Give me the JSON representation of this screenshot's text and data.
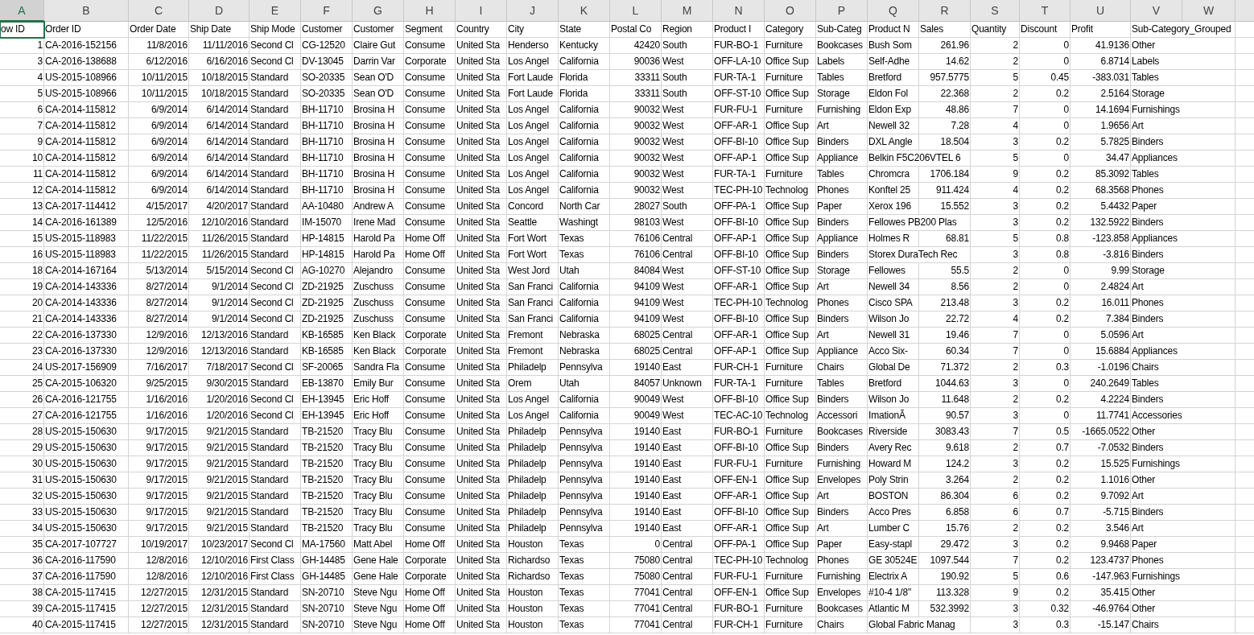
{
  "columns": [
    {
      "letter": "A",
      "kind": "number",
      "selected": true
    },
    {
      "letter": "B",
      "kind": "text",
      "selected": false
    },
    {
      "letter": "C",
      "kind": "number",
      "selected": false
    },
    {
      "letter": "D",
      "kind": "number",
      "selected": false
    },
    {
      "letter": "E",
      "kind": "text",
      "selected": false
    },
    {
      "letter": "F",
      "kind": "text",
      "selected": false
    },
    {
      "letter": "G",
      "kind": "text",
      "selected": false
    },
    {
      "letter": "H",
      "kind": "text",
      "selected": false
    },
    {
      "letter": "I",
      "kind": "text",
      "selected": false
    },
    {
      "letter": "J",
      "kind": "text",
      "selected": false
    },
    {
      "letter": "K",
      "kind": "text",
      "selected": false
    },
    {
      "letter": "L",
      "kind": "number",
      "selected": false
    },
    {
      "letter": "M",
      "kind": "text",
      "selected": false
    },
    {
      "letter": "N",
      "kind": "text",
      "selected": false
    },
    {
      "letter": "O",
      "kind": "text",
      "selected": false
    },
    {
      "letter": "P",
      "kind": "text",
      "selected": false
    },
    {
      "letter": "Q",
      "kind": "text",
      "selected": false
    },
    {
      "letter": "R",
      "kind": "number",
      "selected": false
    },
    {
      "letter": "S",
      "kind": "number",
      "selected": false
    },
    {
      "letter": "T",
      "kind": "number",
      "selected": false
    },
    {
      "letter": "U",
      "kind": "number",
      "selected": false
    },
    {
      "letter": "V",
      "kind": "text",
      "selected": false
    },
    {
      "letter": "W",
      "selected": false
    }
  ],
  "header_row": [
    {
      "text": "ow ID",
      "selected": true
    },
    {
      "text": "Order ID",
      "selected": false
    },
    {
      "text": "Order Date",
      "selected": false
    },
    {
      "text": "Ship Date",
      "selected": false
    },
    {
      "text": "Ship Mode",
      "selected": false
    },
    {
      "text": "Customer",
      "selected": false
    },
    {
      "text": "Customer",
      "selected": false
    },
    {
      "text": "Segment",
      "selected": false
    },
    {
      "text": "Country",
      "selected": false
    },
    {
      "text": "City",
      "selected": false
    },
    {
      "text": "State",
      "selected": false
    },
    {
      "text": "Postal Co",
      "selected": false
    },
    {
      "text": "Region",
      "selected": false
    },
    {
      "text": "Product I",
      "selected": false
    },
    {
      "text": "Category",
      "selected": false
    },
    {
      "text": "Sub-Categ",
      "selected": false
    },
    {
      "text": "Product N",
      "selected": false
    },
    {
      "text": "Sales",
      "selected": false
    },
    {
      "text": "Quantity",
      "selected": false
    },
    {
      "text": "Discount",
      "selected": false
    },
    {
      "text": "Profit",
      "selected": false
    },
    {
      "text": "Sub-Category_Grouped",
      "selected": false
    }
  ],
  "rows": [
    [
      "1",
      "CA-2016-152156",
      "11/8/2016",
      "11/11/2016",
      "Second Cl",
      "CG-12520",
      "Claire Gut",
      "Consume",
      "United Sta",
      "Henderso",
      "Kentucky",
      "42420",
      "South",
      "FUR-BO-1",
      "Furniture",
      "Bookcases",
      "Bush Som",
      "261.96",
      "2",
      "0",
      "41.9136",
      "Other"
    ],
    [
      "3",
      "CA-2016-138688",
      "6/12/2016",
      "6/16/2016",
      "Second Cl",
      "DV-13045",
      "Darrin Var",
      "Corporate",
      "United Sta",
      "Los Angel",
      "California",
      "90036",
      "West",
      "OFF-LA-10",
      "Office Sup",
      "Labels",
      "Self-Adhe",
      "14.62",
      "2",
      "0",
      "6.8714",
      "Labels"
    ],
    [
      "4",
      "US-2015-108966",
      "10/11/2015",
      "10/18/2015",
      "Standard",
      "SO-20335",
      "Sean O'D",
      "Consume",
      "United Sta",
      "Fort Laude",
      "Florida",
      "33311",
      "South",
      "FUR-TA-1",
      "Furniture",
      "Tables",
      "Bretford",
      "957.5775",
      "5",
      "0.45",
      "-383.031",
      "Tables"
    ],
    [
      "5",
      "US-2015-108966",
      "10/11/2015",
      "10/18/2015",
      "Standard",
      "SO-20335",
      "Sean O'D",
      "Consume",
      "United Sta",
      "Fort Laude",
      "Florida",
      "33311",
      "South",
      "OFF-ST-10",
      "Office Sup",
      "Storage",
      "Eldon Fol",
      "22.368",
      "2",
      "0.2",
      "2.5164",
      "Storage"
    ],
    [
      "6",
      "CA-2014-115812",
      "6/9/2014",
      "6/14/2014",
      "Standard",
      "BH-11710",
      "Brosina H",
      "Consume",
      "United Sta",
      "Los Angel",
      "California",
      "90032",
      "West",
      "FUR-FU-1",
      "Furniture",
      "Furnishing",
      "Eldon Exp",
      "48.86",
      "7",
      "0",
      "14.1694",
      "Furnishings"
    ],
    [
      "7",
      "CA-2014-115812",
      "6/9/2014",
      "6/14/2014",
      "Standard",
      "BH-11710",
      "Brosina H",
      "Consume",
      "United Sta",
      "Los Angel",
      "California",
      "90032",
      "West",
      "OFF-AR-1",
      "Office Sup",
      "Art",
      "Newell 32",
      "7.28",
      "4",
      "0",
      "1.9656",
      "Art"
    ],
    [
      "9",
      "CA-2014-115812",
      "6/9/2014",
      "6/14/2014",
      "Standard",
      "BH-11710",
      "Brosina H",
      "Consume",
      "United Sta",
      "Los Angel",
      "California",
      "90032",
      "West",
      "OFF-BI-10",
      "Office Sup",
      "Binders",
      "DXL Angle",
      "18.504",
      "3",
      "0.2",
      "5.7825",
      "Binders"
    ],
    [
      "10",
      "CA-2014-115812",
      "6/9/2014",
      "6/14/2014",
      "Standard",
      "BH-11710",
      "Brosina H",
      "Consume",
      "United Sta",
      "Los Angel",
      "California",
      "90032",
      "West",
      "OFF-AP-1",
      "Office Sup",
      "Appliance",
      "Belkin F5C206VTEL 6",
      null,
      "5",
      "0",
      "34.47",
      "Appliances"
    ],
    [
      "11",
      "CA-2014-115812",
      "6/9/2014",
      "6/14/2014",
      "Standard",
      "BH-11710",
      "Brosina H",
      "Consume",
      "United Sta",
      "Los Angel",
      "California",
      "90032",
      "West",
      "FUR-TA-1",
      "Furniture",
      "Tables",
      "Chromcra",
      "1706.184",
      "9",
      "0.2",
      "85.3092",
      "Tables"
    ],
    [
      "12",
      "CA-2014-115812",
      "6/9/2014",
      "6/14/2014",
      "Standard",
      "BH-11710",
      "Brosina H",
      "Consume",
      "United Sta",
      "Los Angel",
      "California",
      "90032",
      "West",
      "TEC-PH-10",
      "Technolog",
      "Phones",
      "Konftel 25",
      "911.424",
      "4",
      "0.2",
      "68.3568",
      "Phones"
    ],
    [
      "13",
      "CA-2017-114412",
      "4/15/2017",
      "4/20/2017",
      "Standard",
      "AA-10480",
      "Andrew A",
      "Consume",
      "United Sta",
      "Concord",
      "North Car",
      "28027",
      "South",
      "OFF-PA-1",
      "Office Sup",
      "Paper",
      "Xerox 196",
      "15.552",
      "3",
      "0.2",
      "5.4432",
      "Paper"
    ],
    [
      "14",
      "CA-2016-161389",
      "12/5/2016",
      "12/10/2016",
      "Standard",
      "IM-15070",
      "Irene Mad",
      "Consume",
      "United Sta",
      "Seattle",
      "Washingt",
      "98103",
      "West",
      "OFF-BI-10",
      "Office Sup",
      "Binders",
      "Fellowes PB200 Plas",
      null,
      "3",
      "0.2",
      "132.5922",
      "Binders"
    ],
    [
      "15",
      "US-2015-118983",
      "11/22/2015",
      "11/26/2015",
      "Standard",
      "HP-14815",
      "Harold Pa",
      "Home Off",
      "United Sta",
      "Fort Wort",
      "Texas",
      "76106",
      "Central",
      "OFF-AP-1",
      "Office Sup",
      "Appliance",
      "Holmes R",
      "68.81",
      "5",
      "0.8",
      "-123.858",
      "Appliances"
    ],
    [
      "16",
      "US-2015-118983",
      "11/22/2015",
      "11/26/2015",
      "Standard",
      "HP-14815",
      "Harold Pa",
      "Home Off",
      "United Sta",
      "Fort Wort",
      "Texas",
      "76106",
      "Central",
      "OFF-BI-10",
      "Office Sup",
      "Binders",
      "Storex DuraTech Rec",
      null,
      "3",
      "0.8",
      "-3.816",
      "Binders"
    ],
    [
      "18",
      "CA-2014-167164",
      "5/13/2014",
      "5/15/2014",
      "Second Cl",
      "AG-10270",
      "Alejandro",
      "Consume",
      "United Sta",
      "West Jord",
      "Utah",
      "84084",
      "West",
      "OFF-ST-10",
      "Office Sup",
      "Storage",
      "Fellowes",
      "55.5",
      "2",
      "0",
      "9.99",
      "Storage"
    ],
    [
      "19",
      "CA-2014-143336",
      "8/27/2014",
      "9/1/2014",
      "Second Cl",
      "ZD-21925",
      "Zuschuss",
      "Consume",
      "United Sta",
      "San Franci",
      "California",
      "94109",
      "West",
      "OFF-AR-1",
      "Office Sup",
      "Art",
      "Newell 34",
      "8.56",
      "2",
      "0",
      "2.4824",
      "Art"
    ],
    [
      "20",
      "CA-2014-143336",
      "8/27/2014",
      "9/1/2014",
      "Second Cl",
      "ZD-21925",
      "Zuschuss",
      "Consume",
      "United Sta",
      "San Franci",
      "California",
      "94109",
      "West",
      "TEC-PH-10",
      "Technolog",
      "Phones",
      "Cisco SPA",
      "213.48",
      "3",
      "0.2",
      "16.011",
      "Phones"
    ],
    [
      "21",
      "CA-2014-143336",
      "8/27/2014",
      "9/1/2014",
      "Second Cl",
      "ZD-21925",
      "Zuschuss",
      "Consume",
      "United Sta",
      "San Franci",
      "California",
      "94109",
      "West",
      "OFF-BI-10",
      "Office Sup",
      "Binders",
      "Wilson Jo",
      "22.72",
      "4",
      "0.2",
      "7.384",
      "Binders"
    ],
    [
      "22",
      "CA-2016-137330",
      "12/9/2016",
      "12/13/2016",
      "Standard",
      "KB-16585",
      "Ken Black",
      "Corporate",
      "United Sta",
      "Fremont",
      "Nebraska",
      "68025",
      "Central",
      "OFF-AR-1",
      "Office Sup",
      "Art",
      "Newell 31",
      "19.46",
      "7",
      "0",
      "5.0596",
      "Art"
    ],
    [
      "23",
      "CA-2016-137330",
      "12/9/2016",
      "12/13/2016",
      "Standard",
      "KB-16585",
      "Ken Black",
      "Corporate",
      "United Sta",
      "Fremont",
      "Nebraska",
      "68025",
      "Central",
      "OFF-AP-1",
      "Office Sup",
      "Appliance",
      "Acco Six-",
      "60.34",
      "7",
      "0",
      "15.6884",
      "Appliances"
    ],
    [
      "24",
      "US-2017-156909",
      "7/16/2017",
      "7/18/2017",
      "Second Cl",
      "SF-20065",
      "Sandra Fla",
      "Consume",
      "United Sta",
      "Philadelp",
      "Pennsylva",
      "19140",
      "East",
      "FUR-CH-1",
      "Furniture",
      "Chairs",
      "Global De",
      "71.372",
      "2",
      "0.3",
      "-1.0196",
      "Chairs"
    ],
    [
      "25",
      "CA-2015-106320",
      "9/25/2015",
      "9/30/2015",
      "Standard",
      "EB-13870",
      "Emily Bur",
      "Consume",
      "United Sta",
      "Orem",
      "Utah",
      "84057",
      "Unknown",
      "FUR-TA-1",
      "Furniture",
      "Tables",
      "Bretford",
      "1044.63",
      "3",
      "0",
      "240.2649",
      "Tables"
    ],
    [
      "26",
      "CA-2016-121755",
      "1/16/2016",
      "1/20/2016",
      "Second Cl",
      "EH-13945",
      "Eric Hoff",
      "Consume",
      "United Sta",
      "Los Angel",
      "California",
      "90049",
      "West",
      "OFF-BI-10",
      "Office Sup",
      "Binders",
      "Wilson Jo",
      "11.648",
      "2",
      "0.2",
      "4.2224",
      "Binders"
    ],
    [
      "27",
      "CA-2016-121755",
      "1/16/2016",
      "1/20/2016",
      "Second Cl",
      "EH-13945",
      "Eric Hoff",
      "Consume",
      "United Sta",
      "Los Angel",
      "California",
      "90049",
      "West",
      "TEC-AC-10",
      "Technolog",
      "Accessori",
      "ImationÃ",
      "90.57",
      "3",
      "0",
      "11.7741",
      "Accessories"
    ],
    [
      "28",
      "US-2015-150630",
      "9/17/2015",
      "9/21/2015",
      "Standard",
      "TB-21520",
      "Tracy Blu",
      "Consume",
      "United Sta",
      "Philadelp",
      "Pennsylva",
      "19140",
      "East",
      "FUR-BO-1",
      "Furniture",
      "Bookcases",
      "Riverside",
      "3083.43",
      "7",
      "0.5",
      "-1665.0522",
      "Other"
    ],
    [
      "29",
      "US-2015-150630",
      "9/17/2015",
      "9/21/2015",
      "Standard",
      "TB-21520",
      "Tracy Blu",
      "Consume",
      "United Sta",
      "Philadelp",
      "Pennsylva",
      "19140",
      "East",
      "OFF-BI-10",
      "Office Sup",
      "Binders",
      "Avery Rec",
      "9.618",
      "2",
      "0.7",
      "-7.0532",
      "Binders"
    ],
    [
      "30",
      "US-2015-150630",
      "9/17/2015",
      "9/21/2015",
      "Standard",
      "TB-21520",
      "Tracy Blu",
      "Consume",
      "United Sta",
      "Philadelp",
      "Pennsylva",
      "19140",
      "East",
      "FUR-FU-1",
      "Furniture",
      "Furnishing",
      "Howard M",
      "124.2",
      "3",
      "0.2",
      "15.525",
      "Furnishings"
    ],
    [
      "31",
      "US-2015-150630",
      "9/17/2015",
      "9/21/2015",
      "Standard",
      "TB-21520",
      "Tracy Blu",
      "Consume",
      "United Sta",
      "Philadelp",
      "Pennsylva",
      "19140",
      "East",
      "OFF-EN-1",
      "Office Sup",
      "Envelopes",
      "Poly Strin",
      "3.264",
      "2",
      "0.2",
      "1.1016",
      "Other"
    ],
    [
      "32",
      "US-2015-150630",
      "9/17/2015",
      "9/21/2015",
      "Standard",
      "TB-21520",
      "Tracy Blu",
      "Consume",
      "United Sta",
      "Philadelp",
      "Pennsylva",
      "19140",
      "East",
      "OFF-AR-1",
      "Office Sup",
      "Art",
      "BOSTON",
      "86.304",
      "6",
      "0.2",
      "9.7092",
      "Art"
    ],
    [
      "33",
      "US-2015-150630",
      "9/17/2015",
      "9/21/2015",
      "Standard",
      "TB-21520",
      "Tracy Blu",
      "Consume",
      "United Sta",
      "Philadelp",
      "Pennsylva",
      "19140",
      "East",
      "OFF-BI-10",
      "Office Sup",
      "Binders",
      "Acco Pres",
      "6.858",
      "6",
      "0.7",
      "-5.715",
      "Binders"
    ],
    [
      "34",
      "US-2015-150630",
      "9/17/2015",
      "9/21/2015",
      "Standard",
      "TB-21520",
      "Tracy Blu",
      "Consume",
      "United Sta",
      "Philadelp",
      "Pennsylva",
      "19140",
      "East",
      "OFF-AR-1",
      "Office Sup",
      "Art",
      "Lumber C",
      "15.76",
      "2",
      "0.2",
      "3.546",
      "Art"
    ],
    [
      "35",
      "CA-2017-107727",
      "10/19/2017",
      "10/23/2017",
      "Second Cl",
      "MA-17560",
      "Matt Abel",
      "Home Off",
      "United Sta",
      "Houston",
      "Texas",
      "0",
      "Central",
      "OFF-PA-1",
      "Office Sup",
      "Paper",
      "Easy-stapl",
      "29.472",
      "3",
      "0.2",
      "9.9468",
      "Paper"
    ],
    [
      "36",
      "CA-2016-117590",
      "12/8/2016",
      "12/10/2016",
      "First Class",
      "GH-14485",
      "Gene Hale",
      "Corporate",
      "United Sta",
      "Richardso",
      "Texas",
      "75080",
      "Central",
      "TEC-PH-10",
      "Technolog",
      "Phones",
      "GE 30524E",
      "1097.544",
      "7",
      "0.2",
      "123.4737",
      "Phones"
    ],
    [
      "37",
      "CA-2016-117590",
      "12/8/2016",
      "12/10/2016",
      "First Class",
      "GH-14485",
      "Gene Hale",
      "Corporate",
      "United Sta",
      "Richardso",
      "Texas",
      "75080",
      "Central",
      "FUR-FU-1",
      "Furniture",
      "Furnishing",
      "Electrix A",
      "190.92",
      "5",
      "0.6",
      "-147.963",
      "Furnishings"
    ],
    [
      "38",
      "CA-2015-117415",
      "12/27/2015",
      "12/31/2015",
      "Standard",
      "SN-20710",
      "Steve Ngu",
      "Home Off",
      "United Sta",
      "Houston",
      "Texas",
      "77041",
      "Central",
      "OFF-EN-1",
      "Office Sup",
      "Envelopes",
      "#10-4 1/8\"",
      "113.328",
      "9",
      "0.2",
      "35.415",
      "Other"
    ],
    [
      "39",
      "CA-2015-117415",
      "12/27/2015",
      "12/31/2015",
      "Standard",
      "SN-20710",
      "Steve Ngu",
      "Home Off",
      "United Sta",
      "Houston",
      "Texas",
      "77041",
      "Central",
      "FUR-BO-1",
      "Furniture",
      "Bookcases",
      "Atlantic M",
      "532.3992",
      "3",
      "0.32",
      "-46.9764",
      "Other"
    ],
    [
      "40",
      "CA-2015-117415",
      "12/27/2015",
      "12/31/2015",
      "Standard",
      "SN-20710",
      "Steve Ngu",
      "Home Off",
      "United Sta",
      "Houston",
      "Texas",
      "77041",
      "Central",
      "FUR-CH-1",
      "Furniture",
      "Chairs",
      "Global Fabric Manag",
      null,
      "3",
      "0.3",
      "-15.147",
      "Chairs"
    ]
  ]
}
